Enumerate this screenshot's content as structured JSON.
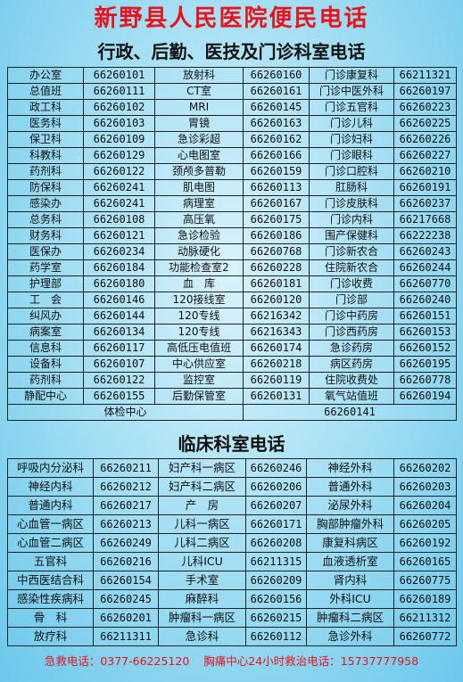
{
  "title": "新野县人民医院便民电话",
  "section1_title": "行政、后勤、医技及门诊科室电话",
  "section1_rows": [
    [
      "办公室",
      "66260101",
      "放射科",
      "66260160",
      "门诊康复科",
      "66211321"
    ],
    [
      "总值班",
      "66260111",
      "CT室",
      "66260161",
      "门诊中医外科",
      "66260197"
    ],
    [
      "政工科",
      "66260102",
      "MRI",
      "66260145",
      "门诊五官科",
      "66260223"
    ],
    [
      "医务科",
      "66260103",
      "胃镜",
      "66260163",
      "门诊儿科",
      "66260225"
    ],
    [
      "保卫科",
      "66260109",
      "急诊彩超",
      "66260162",
      "门诊妇科",
      "66260226"
    ],
    [
      "科教科",
      "66260129",
      "心电图室",
      "66260166",
      "门诊眼科",
      "66260227"
    ],
    [
      "药剂科",
      "66260122",
      "颈颅多普勒",
      "66260159",
      "门诊口腔科",
      "66260210"
    ],
    [
      "防保科",
      "66260241",
      "肌电图",
      "66260113",
      "肛肠科",
      "66260191"
    ],
    [
      "感染办",
      "66260241",
      "病理室",
      "66260167",
      "门诊皮肤科",
      "66260237"
    ],
    [
      "总务科",
      "66260108",
      "高压氧",
      "66260175",
      "门诊内科",
      "66217668"
    ],
    [
      "财务科",
      "66260121",
      "急诊检验",
      "66260186",
      "围产保健科",
      "66222238"
    ],
    [
      "医保办",
      "66260234",
      "动脉硬化",
      "66260768",
      "门诊新农合",
      "66260243"
    ],
    [
      "药学室",
      "66260184",
      "功能检查室2",
      "66260228",
      "住院新农合",
      "66260244"
    ],
    [
      "护理部",
      "66260180",
      "血　库",
      "66260181",
      "门诊收费",
      "66260770"
    ],
    [
      "工　会",
      "66260146",
      "120接线室",
      "66260120",
      "门诊部",
      "66260240"
    ],
    [
      "纠风办",
      "66260144",
      "120专线",
      "66216342",
      "门诊中药房",
      "66260151"
    ],
    [
      "病案室",
      "66260134",
      "120专线",
      "66216343",
      "门诊西药房",
      "66260153"
    ],
    [
      "信息科",
      "66260117",
      "高低压电值班",
      "66260174",
      "急诊药房",
      "66260152"
    ],
    [
      "设备科",
      "66260107",
      "中心供应室",
      "66260218",
      "病区药房",
      "66260195"
    ],
    [
      "药剂科",
      "66260122",
      "监控室",
      "66260119",
      "住院收费处",
      "66260778"
    ],
    [
      "静配中心",
      "66260155",
      "后勤保管室",
      "66260131",
      "氧气站值班",
      "66260194"
    ]
  ],
  "section1_last": {
    "label": "体检中心",
    "number": "66260141"
  },
  "section2_title": "临床科室电话",
  "section2_rows": [
    [
      "呼吸内分泌科",
      "66260211",
      "妇产科一病区",
      "66260246",
      "神经外科",
      "66260202"
    ],
    [
      "神经内科",
      "66260212",
      "妇产科二病区",
      "66260206",
      "普通外科",
      "66260203"
    ],
    [
      "普通内科",
      "66260217",
      "产　房",
      "66260207",
      "泌尿外科",
      "66260204"
    ],
    [
      "心血管一病区",
      "66260213",
      "儿科一病区",
      "66260171",
      "胸部肿瘤外科",
      "66260205"
    ],
    [
      "心血管二病区",
      "66260249",
      "儿科二病区",
      "66260208",
      "康复科病区",
      "66260192"
    ],
    [
      "五官科",
      "66260216",
      "儿科ICU",
      "66211315",
      "血液透析室",
      "66260165"
    ],
    [
      "中西医结合科",
      "66260154",
      "手术室",
      "66260209",
      "肾内科",
      "66260775"
    ],
    [
      "感染性疾病科",
      "66260245",
      "麻醉科",
      "66260156",
      "外科ICU",
      "66260189"
    ],
    [
      "骨　科",
      "66260201",
      "肿瘤科一病区",
      "66260215",
      "肿瘤科二病区",
      "66211312"
    ],
    [
      "放疗科",
      "66211311",
      "急诊科",
      "66260112",
      "急诊外科",
      "66260772"
    ]
  ],
  "footer": {
    "emergency": "急救电话：0377-66225120",
    "chest_pain": "胸痛中心24小时救治电话：15737777958"
  },
  "colors": {
    "title": "#e8131b",
    "background": "#9ddcf3",
    "border": "#222222"
  }
}
